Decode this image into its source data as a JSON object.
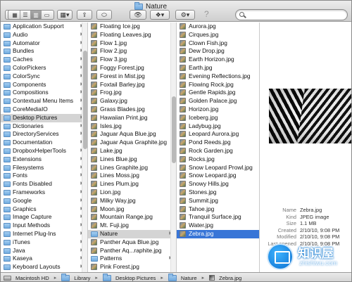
{
  "window": {
    "title": "Nature"
  },
  "toolbar": {
    "view_buttons": [
      "icon-view",
      "list-view",
      "column-view",
      "coverflow-view"
    ],
    "arrange_label": "▦▾",
    "share_label": "⇪",
    "tags_label": "⬭",
    "quicklook_label": "👁",
    "dropbox_label": "❖▾",
    "action_label": "⚙▾",
    "help_label": "?",
    "search_placeholder": ""
  },
  "column1": {
    "items": [
      {
        "label": "Application Support",
        "type": "folder"
      },
      {
        "label": "Audio",
        "type": "folder"
      },
      {
        "label": "Automator",
        "type": "folder"
      },
      {
        "label": "Bundles",
        "type": "folder"
      },
      {
        "label": "Caches",
        "type": "folder"
      },
      {
        "label": "ColorPickers",
        "type": "folder"
      },
      {
        "label": "ColorSync",
        "type": "folder"
      },
      {
        "label": "Components",
        "type": "folder"
      },
      {
        "label": "Compositions",
        "type": "folder"
      },
      {
        "label": "Contextual Menu Items",
        "type": "folder"
      },
      {
        "label": "CoreMediaIO",
        "type": "folder"
      },
      {
        "label": "Desktop Pictures",
        "type": "folder",
        "selected": true
      },
      {
        "label": "Dictionaries",
        "type": "folder"
      },
      {
        "label": "DirectoryServices",
        "type": "folder"
      },
      {
        "label": "Documentation",
        "type": "folder"
      },
      {
        "label": "DropboxHelperTools",
        "type": "folder"
      },
      {
        "label": "Extensions",
        "type": "folder"
      },
      {
        "label": "Filesystems",
        "type": "folder"
      },
      {
        "label": "Fonts",
        "type": "folder"
      },
      {
        "label": "Fonts Disabled",
        "type": "folder"
      },
      {
        "label": "Frameworks",
        "type": "folder"
      },
      {
        "label": "Google",
        "type": "folder"
      },
      {
        "label": "Graphics",
        "type": "folder"
      },
      {
        "label": "Image Capture",
        "type": "folder"
      },
      {
        "label": "Input Methods",
        "type": "folder"
      },
      {
        "label": "Internet Plug-Ins",
        "type": "folder"
      },
      {
        "label": "iTunes",
        "type": "folder"
      },
      {
        "label": "Java",
        "type": "folder"
      },
      {
        "label": "Kaseya",
        "type": "folder"
      },
      {
        "label": "Keyboard Layouts",
        "type": "folder"
      },
      {
        "label": "Keychains",
        "type": "folder"
      },
      {
        "label": "kworking",
        "type": "folder"
      }
    ]
  },
  "column2": {
    "items": [
      {
        "label": "Floating Ice.jpg",
        "type": "image"
      },
      {
        "label": "Floating Leaves.jpg",
        "type": "image"
      },
      {
        "label": "Flow 1.jpg",
        "type": "image"
      },
      {
        "label": "Flow 2.jpg",
        "type": "image"
      },
      {
        "label": "Flow 3.jpg",
        "type": "image"
      },
      {
        "label": "Foggy Forest.jpg",
        "type": "image"
      },
      {
        "label": "Forest in Mist.jpg",
        "type": "image"
      },
      {
        "label": "Foxtail Barley.jpg",
        "type": "image"
      },
      {
        "label": "Frog.jpg",
        "type": "image"
      },
      {
        "label": "Galaxy.jpg",
        "type": "image"
      },
      {
        "label": "Grass Blades.jpg",
        "type": "image"
      },
      {
        "label": "Hawaiian Print.jpg",
        "type": "image"
      },
      {
        "label": "Isles.jpg",
        "type": "image"
      },
      {
        "label": "Jaguar Aqua Blue.jpg",
        "type": "image"
      },
      {
        "label": "Jaguar Aqua Graphite.jpg",
        "type": "image"
      },
      {
        "label": "Lake.jpg",
        "type": "image"
      },
      {
        "label": "Lines Blue.jpg",
        "type": "image"
      },
      {
        "label": "Lines Graphite.jpg",
        "type": "image"
      },
      {
        "label": "Lines Moss.jpg",
        "type": "image"
      },
      {
        "label": "Lines Plum.jpg",
        "type": "image"
      },
      {
        "label": "Lion.jpg",
        "type": "image"
      },
      {
        "label": "Milky Way.jpg",
        "type": "image"
      },
      {
        "label": "Moon.jpg",
        "type": "image"
      },
      {
        "label": "Mountain Range.jpg",
        "type": "image"
      },
      {
        "label": "Mt. Fuji.jpg",
        "type": "image"
      },
      {
        "label": "Nature",
        "type": "folder",
        "selected": true
      },
      {
        "label": "Panther Aqua Blue.jpg",
        "type": "image"
      },
      {
        "label": "Panther Aq...raphite.jpg",
        "type": "image"
      },
      {
        "label": "Patterns",
        "type": "folder"
      },
      {
        "label": "Pink Forest.jpg",
        "type": "image"
      },
      {
        "label": "Pink Lotus Flower.jpg",
        "type": "image"
      },
      {
        "label": "Plants",
        "type": "folder"
      }
    ]
  },
  "column3": {
    "items": [
      {
        "label": "Aurora.jpg"
      },
      {
        "label": "Cirques.jpg"
      },
      {
        "label": "Clown Fish.jpg"
      },
      {
        "label": "Dew Drop.jpg"
      },
      {
        "label": "Earth Horizon.jpg"
      },
      {
        "label": "Earth.jpg"
      },
      {
        "label": "Evening Reflections.jpg"
      },
      {
        "label": "Flowing Rock.jpg"
      },
      {
        "label": "Gentle Rapids.jpg"
      },
      {
        "label": "Golden Palace.jpg"
      },
      {
        "label": "Horizon.jpg"
      },
      {
        "label": "Iceberg.jpg"
      },
      {
        "label": "Ladybug.jpg"
      },
      {
        "label": "Leopard Aurora.jpg"
      },
      {
        "label": "Pond Reeds.jpg"
      },
      {
        "label": "Rock Garden.jpg"
      },
      {
        "label": "Rocks.jpg"
      },
      {
        "label": "Snow Leopard Prowl.jpg"
      },
      {
        "label": "Snow Leopard.jpg"
      },
      {
        "label": "Snowy Hills.jpg"
      },
      {
        "label": "Stones.jpg"
      },
      {
        "label": "Summit.jpg"
      },
      {
        "label": "Tahoe.jpg"
      },
      {
        "label": "Tranquil Surface.jpg"
      },
      {
        "label": "Water.jpg"
      },
      {
        "label": "Zebra.jpg",
        "selected": true
      }
    ]
  },
  "preview": {
    "image_name": "zebra-preview",
    "fields": [
      {
        "key": "Name",
        "value": "Zebra.jpg"
      },
      {
        "key": "Kind",
        "value": "JPEG image"
      },
      {
        "key": "Size",
        "value": "1.1 MB"
      },
      {
        "key": "Created",
        "value": "2/10/10, 9:08 PM"
      },
      {
        "key": "Modified",
        "value": "2/10/10, 9:08 PM"
      },
      {
        "key": "Last opened",
        "value": "2/10/10, 9:08 PM"
      }
    ]
  },
  "pathbar": {
    "crumbs": [
      "Macintosh HD",
      "Library",
      "Desktop Pictures",
      "Nature",
      "Zebra.jpg"
    ]
  },
  "watermark": {
    "title": "知识屋",
    "subtitle": "zhishiwu.com"
  },
  "colors": {
    "selection_blue": "#3875d7",
    "selection_grey": "#d4d4d4",
    "folder_blue": "#71acdf"
  }
}
